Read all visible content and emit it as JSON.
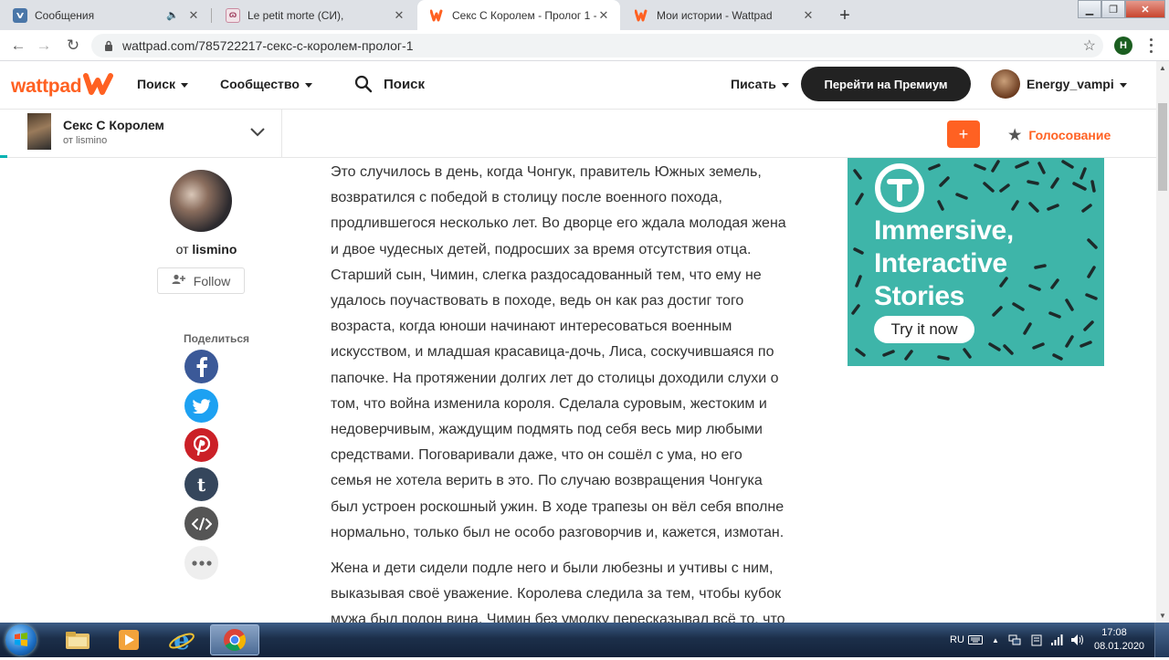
{
  "browser": {
    "tabs": [
      {
        "title": "Сообщения",
        "icon": "vk-icon",
        "active": false
      },
      {
        "title": "Le petit morte (СИ),",
        "icon": "ficbook-icon",
        "active": false
      },
      {
        "title": "Секс С Королем - Пролог 1 - W",
        "icon": "wattpad-icon",
        "active": true
      },
      {
        "title": "Мои истории - Wattpad",
        "icon": "wattpad-icon",
        "active": false
      }
    ],
    "url": "wattpad.com/785722217-секс-с-королем-пролог-1",
    "profile_initial": "H"
  },
  "header": {
    "logo_text": "wattpad",
    "nav_search": "Поиск",
    "nav_community": "Сообщество",
    "search_label": "Поиск",
    "write": "Писать",
    "premium": "Перейти на Премиум",
    "username": "Energy_vampi"
  },
  "story": {
    "title": "Секс С Королем",
    "author_line": "от lismino",
    "add_label": "+",
    "vote_label": "Голосование"
  },
  "author": {
    "prefix": "от",
    "name": "lismino",
    "follow": "Follow",
    "share_label": "Поделиться"
  },
  "content": {
    "paragraphs": [
      "Это случилось в день, когда Чонгук, правитель Южных земель, возвратился с победой в столицу после военного похода, продлившегося несколько лет. Во дворце его ждала молодая жена и двое чудесных детей, подросших за время отсутствия отца. Старший сын, Чимин, слегка раздосадованный тем, что ему не удалось поучаствовать в походе, ведь он как раз достиг того возраста, когда юноши начинают интересоваться военным искусством, и младшая красавица-дочь, Лиса, соскучившаяся по папочке. На протяжении долгих лет до столицы доходили слухи о том, что война изменила короля. Сделала суровым, жестоким и недоверчивым, жаждущим подмять под себя весь мир любыми средствами. Поговаривали даже, что он сошёл с ума, но его семья не хотела верить в это. По случаю возвращения Чонгука был устроен роскошный ужин. В ходе трапезы он вёл себя вполне нормально, только был не особо разговорчив и, кажется, измотан.",
      "Жена и дети сидели подле него и были любезны и учтивы с ним, выказывая своё уважение. Королева следила за тем, чтобы кубок мужа был полон вина. Чимин без умолку пересказывал всё то, что"
    ]
  },
  "ad": {
    "line1": "Immersive,",
    "line2": "Interactive",
    "line3": "Stories",
    "cta": "Try it now",
    "bg_color": "#3eb5a9"
  },
  "taskbar": {
    "lang": "RU",
    "time": "17:08",
    "date": "08.01.2020"
  },
  "colors": {
    "brand_orange": "#ff6122",
    "dark": "#222222"
  }
}
